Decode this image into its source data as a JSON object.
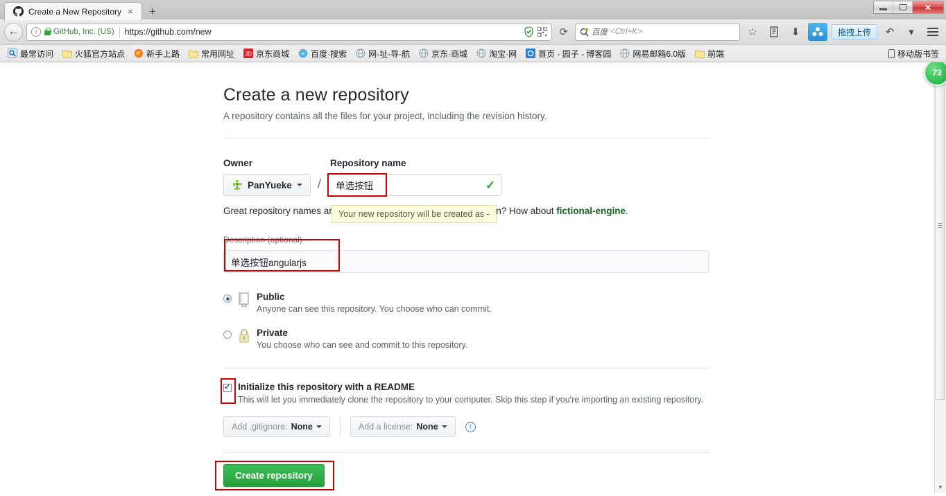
{
  "browser": {
    "tab": {
      "title": "Create a New Repository",
      "favicon": "github-icon",
      "close_label": "×"
    },
    "new_tab_label": "+",
    "window_controls": {
      "minimize": "minimize-button",
      "maximize": "maximize-button",
      "close": "✕"
    },
    "nav": {
      "back_label": "←"
    },
    "url": {
      "site_owner": "GitHub, Inc. (US)",
      "address": "https://github.com/new",
      "reload_label": "⟳"
    },
    "search": {
      "engine": "百度",
      "hint": "<Ctrl+K>"
    },
    "toolbar": {
      "bookmark_star": "☆",
      "library": "library-icon",
      "downloads": "⬇",
      "cloud_label": "baidu-cloud-icon",
      "cloud_tooltip": "拖拽上传",
      "history_back": "↶",
      "history_more": "▾",
      "menu": "hamburger-menu-icon"
    },
    "bookmarks": [
      {
        "label": "最常访问",
        "icon": "most-visited-icon"
      },
      {
        "label": "火狐官方站点",
        "icon": "folder-icon"
      },
      {
        "label": "新手上路",
        "icon": "firefox-icon"
      },
      {
        "label": "常用网址",
        "icon": "folder-icon"
      },
      {
        "label": "京东商城",
        "icon": "jd-icon"
      },
      {
        "label": "百度·搜索",
        "icon": "baidu-icon"
      },
      {
        "label": "网-址-导-航",
        "icon": "globe-icon"
      },
      {
        "label": "京东·商城",
        "icon": "globe-icon"
      },
      {
        "label": "淘宝·网",
        "icon": "globe-icon"
      },
      {
        "label": "首页 - 园子 - 博客园",
        "icon": "cnblogs-icon"
      },
      {
        "label": "网易邮箱6.0版",
        "icon": "globe-icon"
      },
      {
        "label": "前端",
        "icon": "folder-icon"
      }
    ],
    "bookmarks_right": {
      "label": "移动版书签",
      "icon": "mobile-bookmarks-icon"
    }
  },
  "page": {
    "title": "Create a new repository",
    "subtitle": "A repository contains all the files for your project, including the revision history.",
    "owner": {
      "label": "Owner",
      "name": "PanYueke"
    },
    "repository": {
      "label": "Repository name",
      "value": "单选按钮",
      "validity_icon": "✓",
      "tooltip": "Your new repository will be created as -",
      "hint_prefix": "Great repository names are short and memorable. Need inspiration? How about ",
      "hint_suggestion": "fictional-engine",
      "hint_suffix": "."
    },
    "description": {
      "label": "Description",
      "optional": "(optional)",
      "value": "单选按钮angularjs"
    },
    "visibility": [
      {
        "name": "Public",
        "description": "Anyone can see this repository. You choose who can commit.",
        "selected": true,
        "icon": "book-icon"
      },
      {
        "name": "Private",
        "description": "You choose who can see and commit to this repository.",
        "selected": false,
        "icon": "lock-icon"
      }
    ],
    "readme": {
      "label": "Initialize this repository with a README",
      "description": "This will let you immediately clone the repository to your computer. Skip this step if you're importing an existing repository.",
      "checked": true
    },
    "pickers": {
      "gitignore_prefix": "Add .gitignore:",
      "gitignore_value": "None",
      "license_prefix": "Add a license:",
      "license_value": "None",
      "info_icon": "info-icon"
    },
    "submit_label": "Create repository"
  },
  "overlay": {
    "badge_value": "73"
  },
  "colors": {
    "accent_green": "#28a745",
    "submit_green": "#27a03e",
    "highlight_red": "#cc0000",
    "tooltip_bg": "#fdfcdc",
    "link_green": "#1b5e20"
  }
}
